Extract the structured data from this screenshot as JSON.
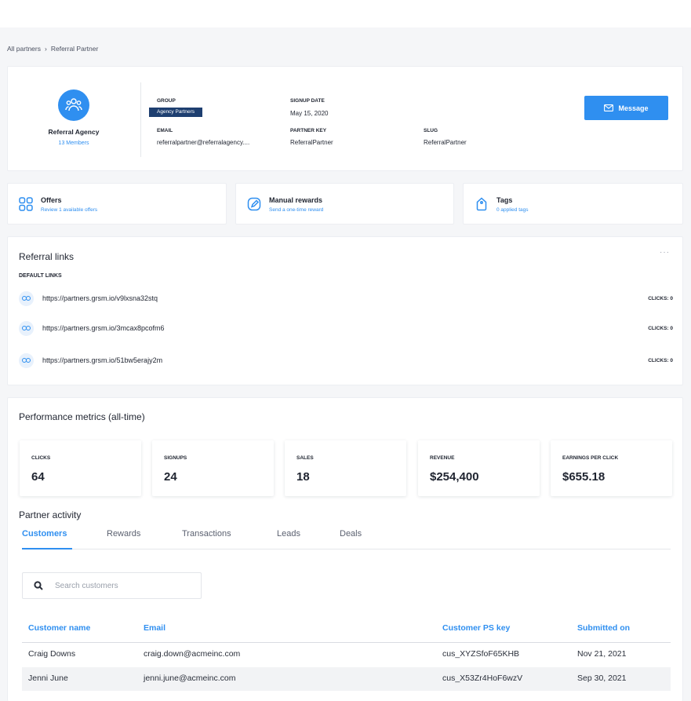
{
  "breadcrumb": {
    "root": "All partners",
    "separator": "›",
    "current": "Referral Partner"
  },
  "profile": {
    "name": "Referral Agency",
    "members": "13 Members",
    "group_label": "GROUP",
    "group_value": "Agency Partners",
    "signup_label": "SIGNUP DATE",
    "signup_value": "May 15, 2020",
    "email_label": "EMAIL",
    "email_value": "referralpartner@referralagency....",
    "key_label": "PARTNER KEY",
    "key_value": "ReferralPartner",
    "slug_label": "SLUG",
    "slug_value": "ReferralPartner",
    "message_button": "Message",
    "icons": {
      "avatar": "users-icon",
      "message": "envelope-icon"
    }
  },
  "quick_cards": [
    {
      "title": "Offers",
      "subtitle": "Review 1 available offers",
      "icon": "grid-icon"
    },
    {
      "title": "Manual rewards",
      "subtitle": "Send a one-time reward",
      "icon": "edit-icon"
    },
    {
      "title": "Tags",
      "subtitle": "0 applied tags",
      "icon": "tag-icon"
    }
  ],
  "referral_links": {
    "title": "Referral links",
    "menu": "···",
    "subheading": "DEFAULT LINKS",
    "links": [
      {
        "url": "https://partners.grsm.io/v9lxsna32stq",
        "clicks": "CLICKS: 0"
      },
      {
        "url": "https://partners.grsm.io/3mcax8pcofm6",
        "clicks": "CLICKS: 0"
      },
      {
        "url": "https://partners.grsm.io/51bw5erajy2m",
        "clicks": "CLICKS: 0"
      }
    ]
  },
  "performance": {
    "title": "Performance metrics (all-time)",
    "metrics": [
      {
        "label": "CLICKS",
        "value": "64"
      },
      {
        "label": "SIGNUPS",
        "value": "24"
      },
      {
        "label": "SALES",
        "value": "18"
      },
      {
        "label": "REVENUE",
        "value": "$254,400"
      },
      {
        "label": "EARNINGS PER CLICK",
        "value": "$655.18"
      }
    ]
  },
  "activity": {
    "title": "Partner activity",
    "tabs": [
      "Customers",
      "Rewards",
      "Transactions",
      "Leads",
      "Deals"
    ],
    "active_tab": "Customers",
    "search_placeholder": "Search customers",
    "columns": [
      "Customer name",
      "Email",
      "Customer PS key",
      "Submitted on"
    ],
    "rows": [
      [
        "Craig Downs",
        "craig.down@acmeinc.com",
        "cus_XYZSfoF65KHB",
        "Nov 21, 2021"
      ],
      [
        "Jenni June",
        "jenni.june@acmeinc.com",
        "cus_X53Zr4HoF6wzV",
        "Sep 30, 2021"
      ]
    ]
  },
  "colors": {
    "accent": "#2f8ff0",
    "badge": "#1e3f70"
  }
}
